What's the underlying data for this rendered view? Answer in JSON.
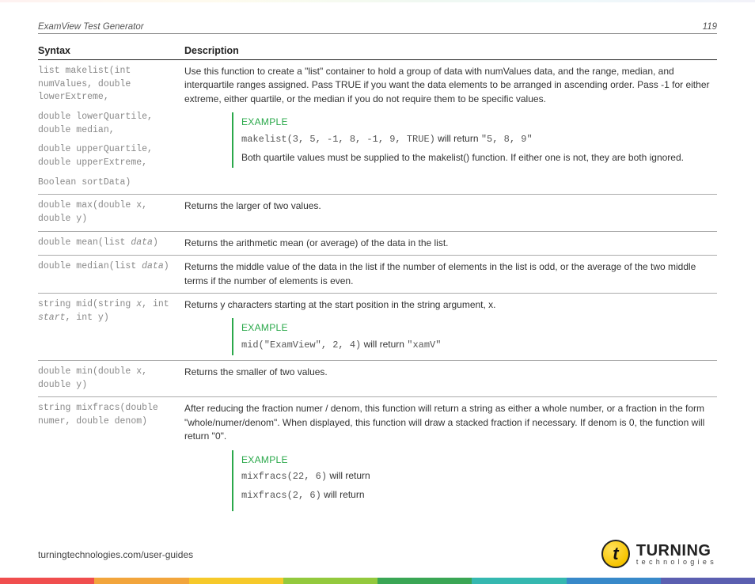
{
  "header": {
    "title": "ExamView Test Generator",
    "pageNumber": "119"
  },
  "table": {
    "headers": {
      "syntax": "Syntax",
      "description": "Description"
    },
    "rows": [
      {
        "syntax": "list makelist(int numValues, double lowerExtreme,\n\ndouble lowerQuartile, double median,\n\ndouble upperQuartile, double upperExtreme,\n\nBoolean sortData)",
        "desc": "Use this function to create a \"list\" container to hold a group of data with numValues data, and the range, median, and interquartile ranges assigned. Pass TRUE if you want the data elements to be arranged in ascending order. Pass -1 for either extreme, either quartile, or the median if you do not require them to be specific values.",
        "example": {
          "label": "EXAMPLE",
          "code": "makelist(3, 5, -1, 8, -1, 9, TRUE)",
          "codeAfter": " will return ",
          "codeResult": "\"5, 8, 9\"",
          "note": "Both quartile values must be supplied to the makelist() function. If either one is not, they are both ignored."
        }
      },
      {
        "syntax": "double max(double x, double y)",
        "desc": "Returns the larger of two values."
      },
      {
        "syntax_html": "double mean(list <i>data</i>)",
        "desc": "Returns the arithmetic mean (or average) of the data in the list."
      },
      {
        "syntax_html": "double median(list <i>data</i>)",
        "desc": "Returns the middle value of the data in the list if the number of elements in the list is odd, or the average of the two middle terms if the number of elements is even."
      },
      {
        "syntax_html": "string mid(string <i>x</i>, int <i>start</i>, int y)",
        "desc": "Returns y characters starting at the start position in the string argument, x.",
        "example": {
          "label": "EXAMPLE",
          "code": "mid(\"ExamView\", 2, 4)",
          "codeAfter": " will return ",
          "codeResult": "\"xamV\""
        }
      },
      {
        "syntax": "double min(double x, double y)",
        "desc": "Returns the smaller of two values."
      },
      {
        "syntax": "string mixfracs(double numer, double denom)",
        "desc": "After reducing the fraction numer / denom, this function will return a string as either a whole number, or a fraction in the form \"whole/numer/denom\". When displayed, this function will draw a stacked fraction if necessary. If denom is 0, the function will return \"0\".",
        "example": {
          "label": "EXAMPLE",
          "lines": [
            {
              "code": "mixfracs(22, 6)",
              "after": " will return"
            },
            {
              "code": "mixfracs(2, 6)",
              "after": " will return"
            }
          ]
        }
      }
    ]
  },
  "footer": {
    "url": "turningtechnologies.com/user-guides"
  },
  "logo": {
    "mark": "t",
    "big": "TURNING",
    "small": "technologies"
  }
}
